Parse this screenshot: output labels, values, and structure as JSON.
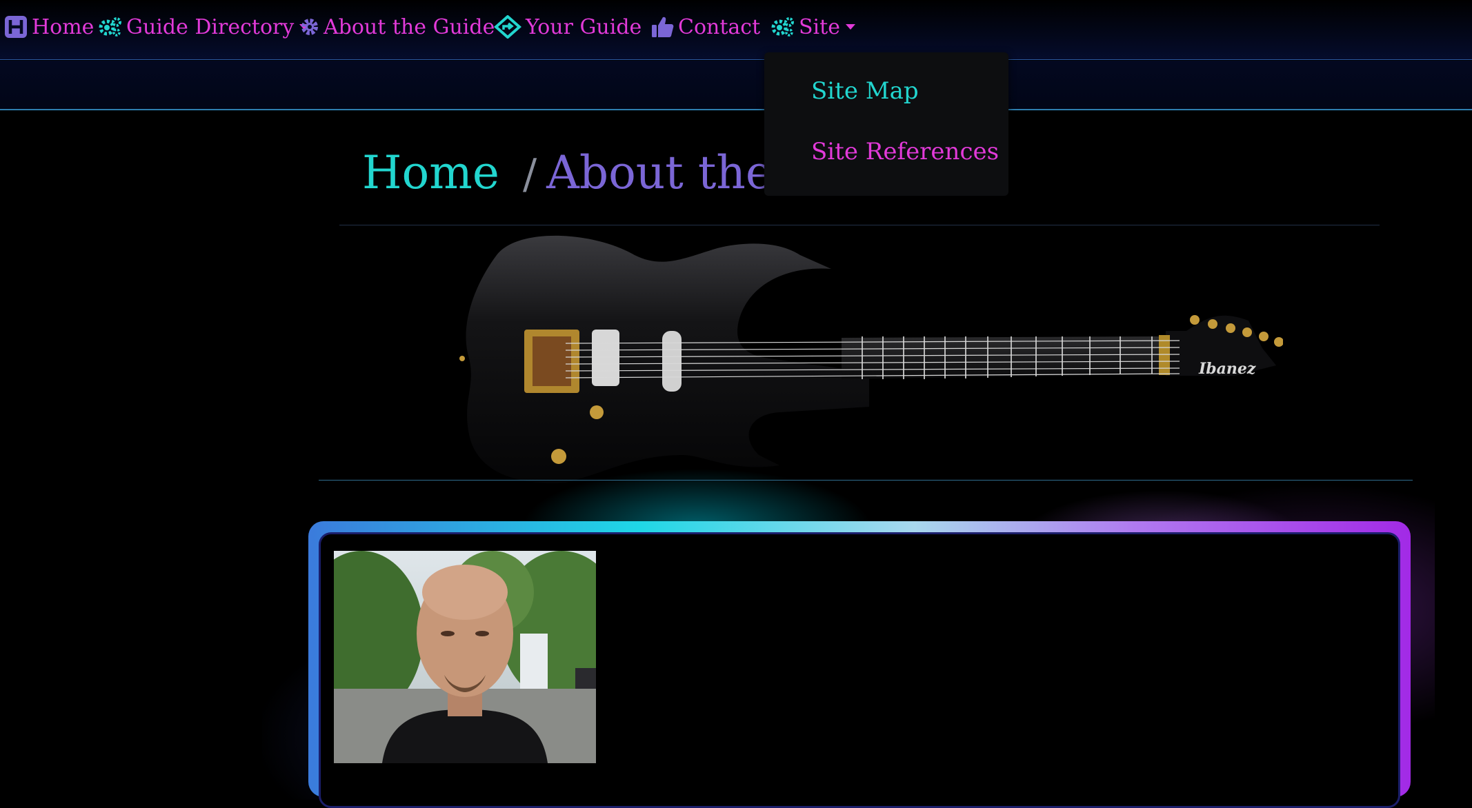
{
  "nav": {
    "home": "Home",
    "guide_directory": "Guide Directory",
    "about_the_guide": "About the Guide",
    "your_guide": "Your Guide",
    "contact": "Contact",
    "site": "Site"
  },
  "site_dropdown": {
    "items": [
      "Site Map",
      "Site References"
    ]
  },
  "breadcrumb": {
    "home": "Home",
    "separator": "/",
    "current": "About the A"
  },
  "guitar": {
    "brand": "Ibanez"
  },
  "colors": {
    "nav_text": "#e23ad9",
    "nav_icon": "#7b66d6",
    "accent_cyan": "#22d6cf",
    "breadcrumb_current": "#7b66d6"
  }
}
